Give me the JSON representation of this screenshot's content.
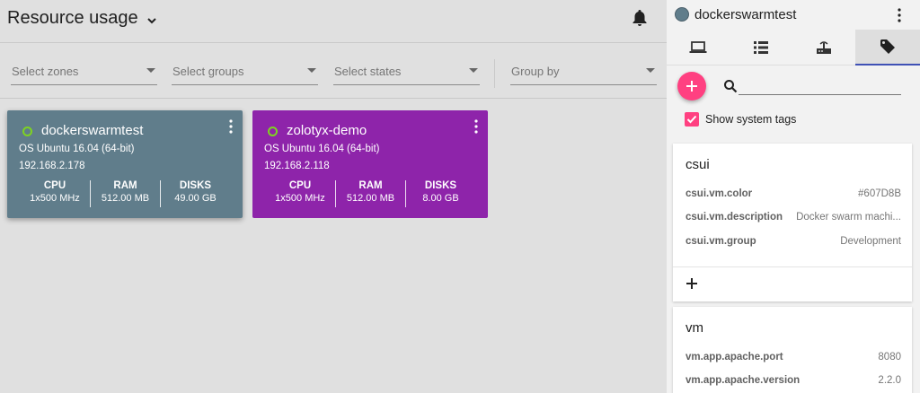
{
  "header": {
    "title": "Resource usage"
  },
  "filters": {
    "zones": "Select zones",
    "groups": "Select groups",
    "states": "Select states",
    "group_by": "Group by"
  },
  "cards": [
    {
      "name": "dockerswarmtest",
      "color": "#607D8B",
      "os": "OS Ubuntu 16.04 (64-bit)",
      "ip": "192.168.2.178",
      "cpu_label": "CPU",
      "cpu": "1x500 MHz",
      "ram_label": "RAM",
      "ram": "512.00 MB",
      "disks_label": "DISKS",
      "disks": "49.00 GB"
    },
    {
      "name": "zolotyx-demo",
      "color": "#8E24AA",
      "os": "OS Ubuntu 16.04 (64-bit)",
      "ip": "192.168.2.118",
      "cpu_label": "CPU",
      "cpu": "1x500 MHz",
      "ram_label": "RAM",
      "ram": "512.00 MB",
      "disks_label": "DISKS",
      "disks": "8.00 GB"
    }
  ],
  "side": {
    "vm_name": "dockerswarmtest",
    "tabs": [
      "laptop-icon",
      "list-icon",
      "router-icon",
      "tag-icon"
    ],
    "active_tab": 3,
    "show_system_tags_label": "Show system tags",
    "show_system_tags": true,
    "tag_groups": [
      {
        "title": "csui",
        "rows": [
          {
            "key": "csui.vm.color",
            "value": "#607D8B"
          },
          {
            "key": "csui.vm.description",
            "value": "Docker swarm machi..."
          },
          {
            "key": "csui.vm.group",
            "value": "Development"
          }
        ]
      },
      {
        "title": "vm",
        "rows": [
          {
            "key": "vm.app.apache.port",
            "value": "8080"
          },
          {
            "key": "vm.app.apache.version",
            "value": "2.2.0"
          }
        ]
      }
    ]
  }
}
